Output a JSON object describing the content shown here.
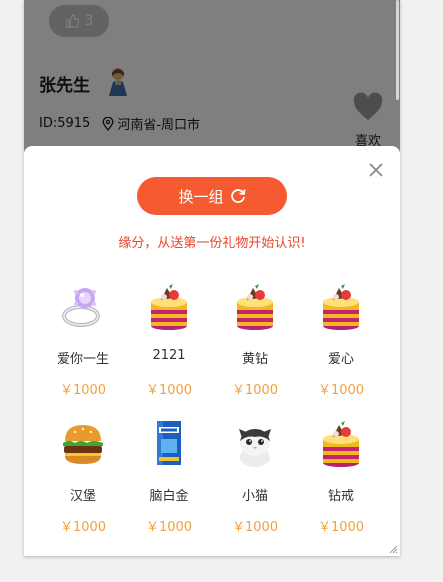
{
  "profile": {
    "likes": "3",
    "name": "张先生",
    "id": "ID:5915",
    "location": "河南省-周口市",
    "fav_label": "喜欢"
  },
  "sheet": {
    "refresh_label": "换一组",
    "tagline": "缘分，从送第一份礼物开始认识!",
    "gifts": [
      {
        "name": "爱你一生",
        "price": "￥1000",
        "icon": "diamond-ring-icon"
      },
      {
        "name": "2121",
        "price": "￥1000",
        "icon": "cake-icon"
      },
      {
        "name": "黄钻",
        "price": "￥1000",
        "icon": "cake-icon"
      },
      {
        "name": "爱心",
        "price": "￥1000",
        "icon": "cake-icon"
      },
      {
        "name": "汉堡",
        "price": "￥1000",
        "icon": "burger-icon"
      },
      {
        "name": "脑白金",
        "price": "￥1000",
        "icon": "gift-box-icon"
      },
      {
        "name": "小猫",
        "price": "￥1000",
        "icon": "kitten-icon"
      },
      {
        "name": "钻戒",
        "price": "￥1000",
        "icon": "cake-icon"
      }
    ]
  },
  "colors": {
    "accent": "#f55a30",
    "tagline": "#e8452c",
    "price": "#f5a03a"
  }
}
